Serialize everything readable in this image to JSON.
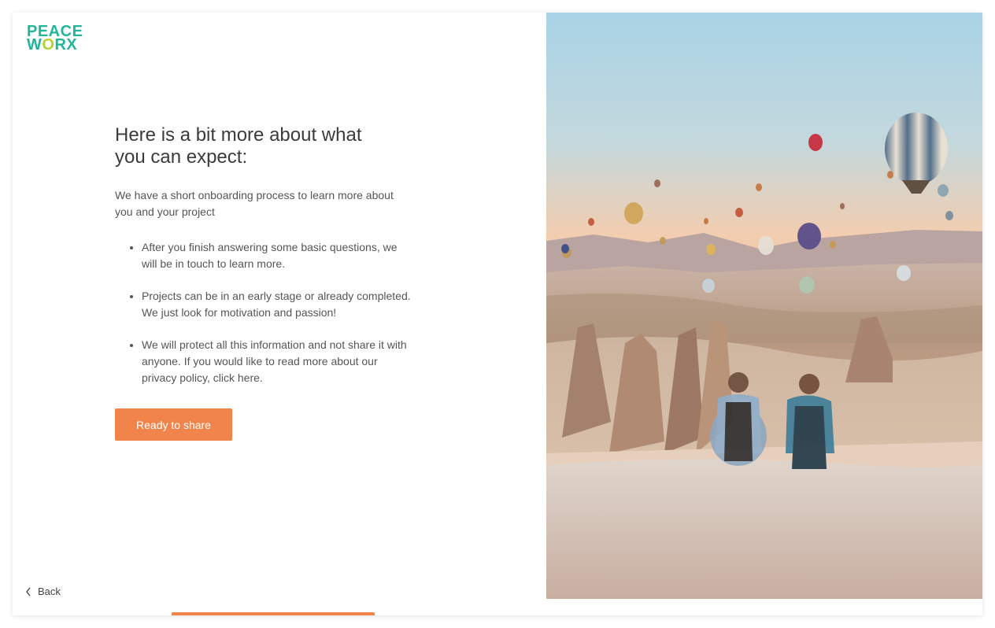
{
  "logo": {
    "line1": "PEACE",
    "line2_a": "W",
    "line2_o": "O",
    "line2_b": "RX"
  },
  "heading": "Here is a bit more about what you can expect:",
  "intro": "We have a short onboarding process to learn more about you and your project",
  "bullets": [
    "After you finish answering some basic questions, we will be in touch to learn more.",
    "Projects can be in an early stage or already completed. We just look for motivation and passion!",
    "We will protect all this information and not share it with anyone. If you would like to read more about our privacy policy, click here."
  ],
  "cta_label": "Ready to share",
  "back_label": "Back",
  "colors": {
    "accent": "#f0844a",
    "brand": "#22b59a",
    "brand_o": "#b6d232"
  },
  "hero_icon": "hot-air-balloon-landscape-photo"
}
